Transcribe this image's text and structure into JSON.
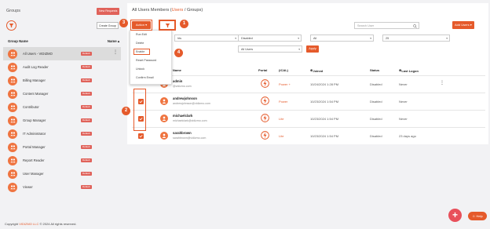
{
  "sidebar": {
    "title": "Groups",
    "new_requests_label": "New Requests",
    "create_group_label": "Create Group",
    "col_group_name": "Group Name",
    "col_name": "Name",
    "sort_indicator": "▴",
    "badge_label": "Default",
    "selected_index": 0,
    "groups": [
      {
        "label": "All Users - VIDIZMO"
      },
      {
        "label": "Audit Log Reader"
      },
      {
        "label": "Billing Manager"
      },
      {
        "label": "Content Manager"
      },
      {
        "label": "Contributor"
      },
      {
        "label": "Group Manager"
      },
      {
        "label": "IT Administrator"
      },
      {
        "label": "Portal Manager"
      },
      {
        "label": "Report Reader"
      },
      {
        "label": "User Manager"
      },
      {
        "label": "Viewer"
      }
    ]
  },
  "main": {
    "breadcrumb_prefix": "All Users Members (",
    "breadcrumb_users": "Users",
    "breadcrumb_sep": "/",
    "breadcrumb_groups": "Groups",
    "breadcrumb_suffix": ")",
    "action_label": "Action",
    "search_placeholder": "Search User",
    "add_users_label": "Add Users",
    "filters": {
      "f1": "",
      "f2": "Disabled",
      "f3": "All",
      "f4": "25",
      "f5": "All Users",
      "partial_text": "hts"
    },
    "apply_label": "Apply",
    "table": {
      "headers": {
        "name": "Name",
        "portal": "Portal",
        "ical": "(iCAL)",
        "joined": "Joined",
        "status": "Status",
        "logon": "Last Logon"
      },
      "rows": [
        {
          "username": "admin",
          "email": "@vidizmo.com",
          "ical": "Power +",
          "joined": "10/24/2024 1:28 PM",
          "status": "Disabled",
          "logon": "Never"
        },
        {
          "username": "andrewjohnson",
          "email": "andrewjohnson@vidizmo.com",
          "ical": "Power",
          "joined": "10/23/2024 1:54 PM",
          "status": "Disabled",
          "logon": "Never"
        },
        {
          "username": "michaelclark",
          "email": "michaelclark@vidizmo.com",
          "ical": "Lite",
          "joined": "10/23/2024 1:54 PM",
          "status": "Disabled",
          "logon": "Never"
        },
        {
          "username": "sarahbrown",
          "email": "sarahbrown@vidizmo.com",
          "ical": "Lite",
          "joined": "10/23/2024 1:54 PM",
          "status": "Disabled",
          "logon": "23 days ago"
        }
      ]
    }
  },
  "action_menu": {
    "items": [
      "Run Edit",
      "Delete",
      "Enable",
      "Reset Password",
      "Unlock",
      "Confirm Email"
    ]
  },
  "callouts": {
    "c1": "1",
    "c2": "2",
    "c3": "3",
    "c4": "4"
  },
  "footer": {
    "prefix": "Copyright",
    "brand": "VIDIZMO LLC",
    "suffix": "© 2024 All rights reserved."
  },
  "fab_label": "+",
  "help_label": "Help",
  "colors": {
    "accent": "#e55a2b",
    "badge": "#e0625a"
  }
}
